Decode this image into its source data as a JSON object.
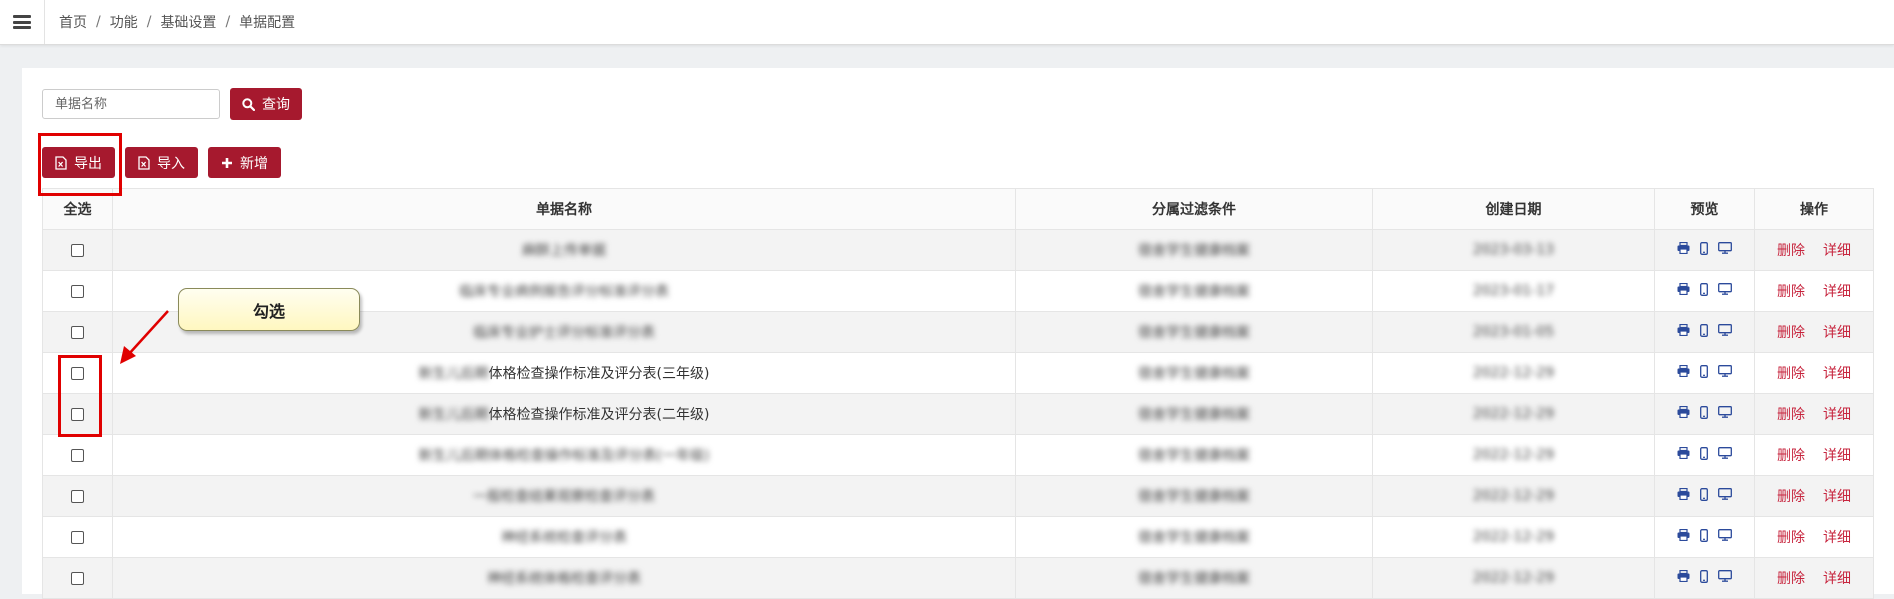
{
  "breadcrumb": [
    "首页",
    "功能",
    "基础设置",
    "单据配置"
  ],
  "search": {
    "placeholder": "单据名称",
    "button_label": "查询"
  },
  "toolbar": {
    "export_label": "导出",
    "import_label": "导入",
    "add_label": "新增"
  },
  "table": {
    "headers": [
      "全选",
      "单据名称",
      "分属过滤条件",
      "创建日期",
      "预览",
      "操作"
    ],
    "row_actions": {
      "delete": "删除",
      "detail": "详细"
    },
    "rows": [
      {
        "name_hidden": "麻醉上传单据",
        "name_visible": "",
        "filter": "宿舍学生健康档案",
        "date": "2023-03-13"
      },
      {
        "name_hidden": "临床专业病例报告评分标准评分表",
        "name_visible": "",
        "filter": "宿舍学生健康档案",
        "date": "2023-01-17"
      },
      {
        "name_hidden": "临床专业护士评分标准评分表",
        "name_visible": "",
        "filter": "宿舍学生健康档案",
        "date": "2023-01-05"
      },
      {
        "name_hidden": "新生儿后期",
        "name_visible": "体格检查操作标准及评分表(三年级)",
        "filter": "宿舍学生健康档案",
        "date": "2022-12-29"
      },
      {
        "name_hidden": "新生儿后期",
        "name_visible": "体格检查操作标准及评分表(二年级)",
        "filter": "宿舍学生健康档案",
        "date": "2022-12-29"
      },
      {
        "name_hidden": "新生儿后期体格检查操作标准及评分表(一年级)",
        "name_visible": "",
        "filter": "宿舍学生健康档案",
        "date": "2022-12-29"
      },
      {
        "name_hidden": "一般检查结果观察检查评分表",
        "name_visible": "",
        "filter": "宿舍学生健康档案",
        "date": "2022-12-29"
      },
      {
        "name_hidden": "神经系统检查评分表",
        "name_visible": "",
        "filter": "宿舍学生健康档案",
        "date": "2022-12-29"
      },
      {
        "name_hidden": "神经系统体格检查评分表",
        "name_visible": "",
        "filter": "宿舍学生健康档案",
        "date": "2022-12-29"
      }
    ]
  },
  "annotation": {
    "callout_text": "勾选"
  },
  "colors": {
    "accent": "#a6192e",
    "link_red": "#c7253e",
    "icon_blue": "#2b4a9b",
    "highlight": "#e00000"
  }
}
